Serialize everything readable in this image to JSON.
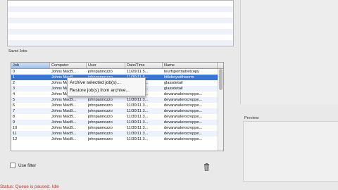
{
  "saved_jobs_label": "Saved Jobs:",
  "preview_label": "Preview:",
  "use_filter_label": "Use filter",
  "status_text": "Status: Queue is paused.  Idle",
  "table": {
    "columns": [
      "Job",
      "Computer",
      "User",
      "Date/Time",
      "Name"
    ],
    "rows": [
      [
        "0",
        "Johns MacB...",
        "johnpannozzo",
        "11/29/11 5...",
        "teurfsportraitretcopy"
      ],
      [
        "1",
        "Johns MacB...",
        "johnpannozzo",
        "11/30/11 5...",
        "littleboywithworm"
      ],
      [
        "2",
        "Johns MacB...",
        "johnpannozzo",
        "11/30/11 5...",
        "glassdetail"
      ],
      [
        "3",
        "Johns MacB...",
        "johnpannozzo",
        "11/30/11 5...",
        "glassdetail"
      ],
      [
        "4",
        "Johns MacB...",
        "johnpannozzo",
        "11/30/11 3...",
        "devaravalerocroppe..."
      ],
      [
        "5",
        "Johns MacB...",
        "johnpannozzo",
        "11/30/11 3...",
        "devaravalerocroppe..."
      ],
      [
        "6",
        "Johns MacB...",
        "johnpannozzo",
        "11/30/11 3...",
        "devaravalerocroppe..."
      ],
      [
        "7",
        "Johns MacB...",
        "johnpannozzo",
        "11/30/11 3...",
        "devaravalerocroppe..."
      ],
      [
        "8",
        "Johns MacB...",
        "johnpannozzo",
        "11/30/11 3...",
        "devaravalerocroppe..."
      ],
      [
        "9",
        "Johns MacB...",
        "johnpannozzo",
        "11/30/11 3...",
        "devaravalerocroppe..."
      ],
      [
        "10",
        "Johns MacB...",
        "johnpannozzo",
        "11/30/11 3...",
        "devaravalerocroppe..."
      ],
      [
        "11",
        "Johns MacB...",
        "johnpannozzo",
        "11/30/11 3...",
        "devaravalerocroppe..."
      ],
      [
        "12",
        "Johns MacB...",
        "johnpannozzo",
        "11/30/11 3...",
        "devaravalerocroppe..."
      ]
    ],
    "selected_row": 1
  },
  "context_menu": {
    "items": [
      "Archive selected job(s)...",
      "Restore job(s) from archive..."
    ]
  },
  "colors": {
    "selection": "#3875d7",
    "status_text": "#c0392b"
  }
}
